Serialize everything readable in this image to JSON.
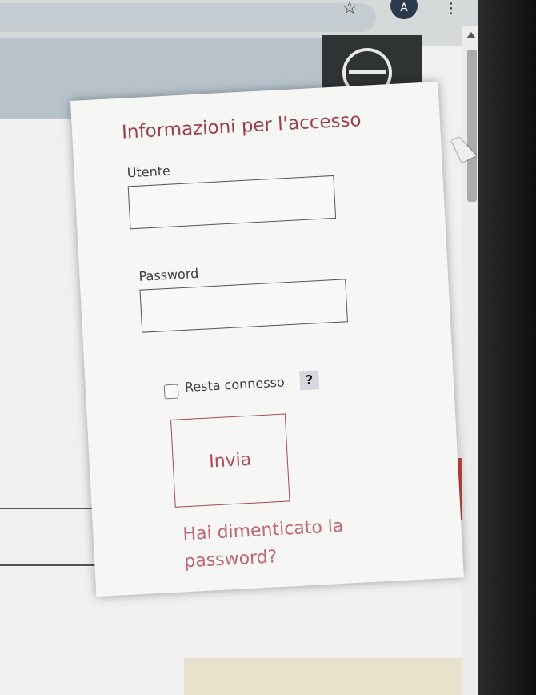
{
  "browser": {
    "avatar_initial": "A",
    "star_icon": "star-icon",
    "menu_icon": "kebab-menu-icon"
  },
  "login_panel": {
    "title": "Informazioni per l'accesso",
    "username_label": "Utente",
    "username_value": "",
    "password_label": "Password",
    "password_value": "",
    "remember_label": "Resta connesso",
    "remember_checked": false,
    "help_label": "?",
    "submit_label": "Invia",
    "forgot_link": "Hai dimenticato la password?"
  },
  "colors": {
    "accent": "#9c3f4f",
    "link": "#c06478",
    "login_tile": "#2f3334"
  }
}
